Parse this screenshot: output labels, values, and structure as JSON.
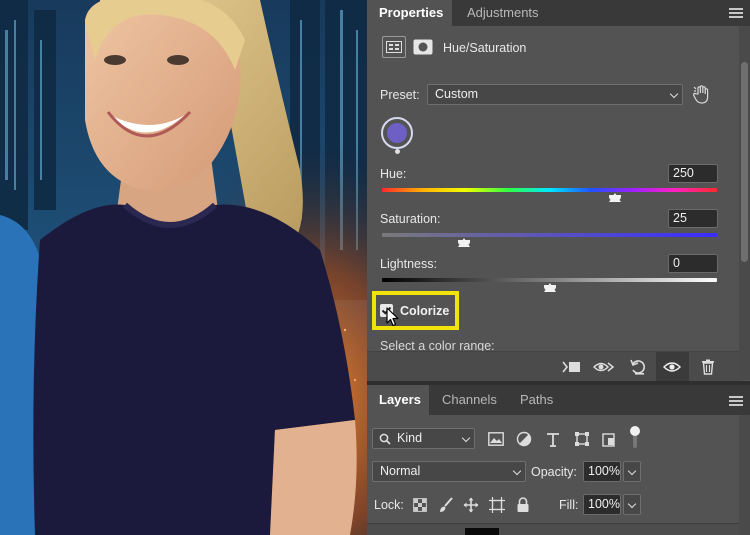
{
  "properties": {
    "tabs": [
      {
        "label": "Properties",
        "active": true
      },
      {
        "label": "Adjustments",
        "active": false
      }
    ],
    "adjustment_title": "Hue/Saturation",
    "preset": {
      "label": "Preset:",
      "value": "Custom"
    },
    "sliders": [
      {
        "label": "Hue:",
        "value": "250"
      },
      {
        "label": "Saturation:",
        "value": "25"
      },
      {
        "label": "Lightness:",
        "value": "0"
      }
    ],
    "colorize": {
      "label": "Colorize",
      "checked": true
    },
    "color_range_label": "Select a color range:",
    "swatch_color": "#6d5fc4",
    "highlight_color": "#f2e40b",
    "footer_icons": [
      "clip-to-layer-icon",
      "view-previous-state-icon",
      "reset-icon",
      "visibility-eye-icon",
      "trash-icon"
    ]
  },
  "layers": {
    "tabs": [
      {
        "label": "Layers",
        "active": true
      },
      {
        "label": "Channels",
        "active": false
      },
      {
        "label": "Paths",
        "active": false
      }
    ],
    "filter": {
      "value": "Kind"
    },
    "blend_mode": {
      "value": "Normal"
    },
    "opacity": {
      "label": "Opacity:",
      "value": "100%"
    },
    "lock": {
      "label": "Lock:"
    },
    "fill": {
      "label": "Fill:",
      "value": "100%"
    }
  }
}
